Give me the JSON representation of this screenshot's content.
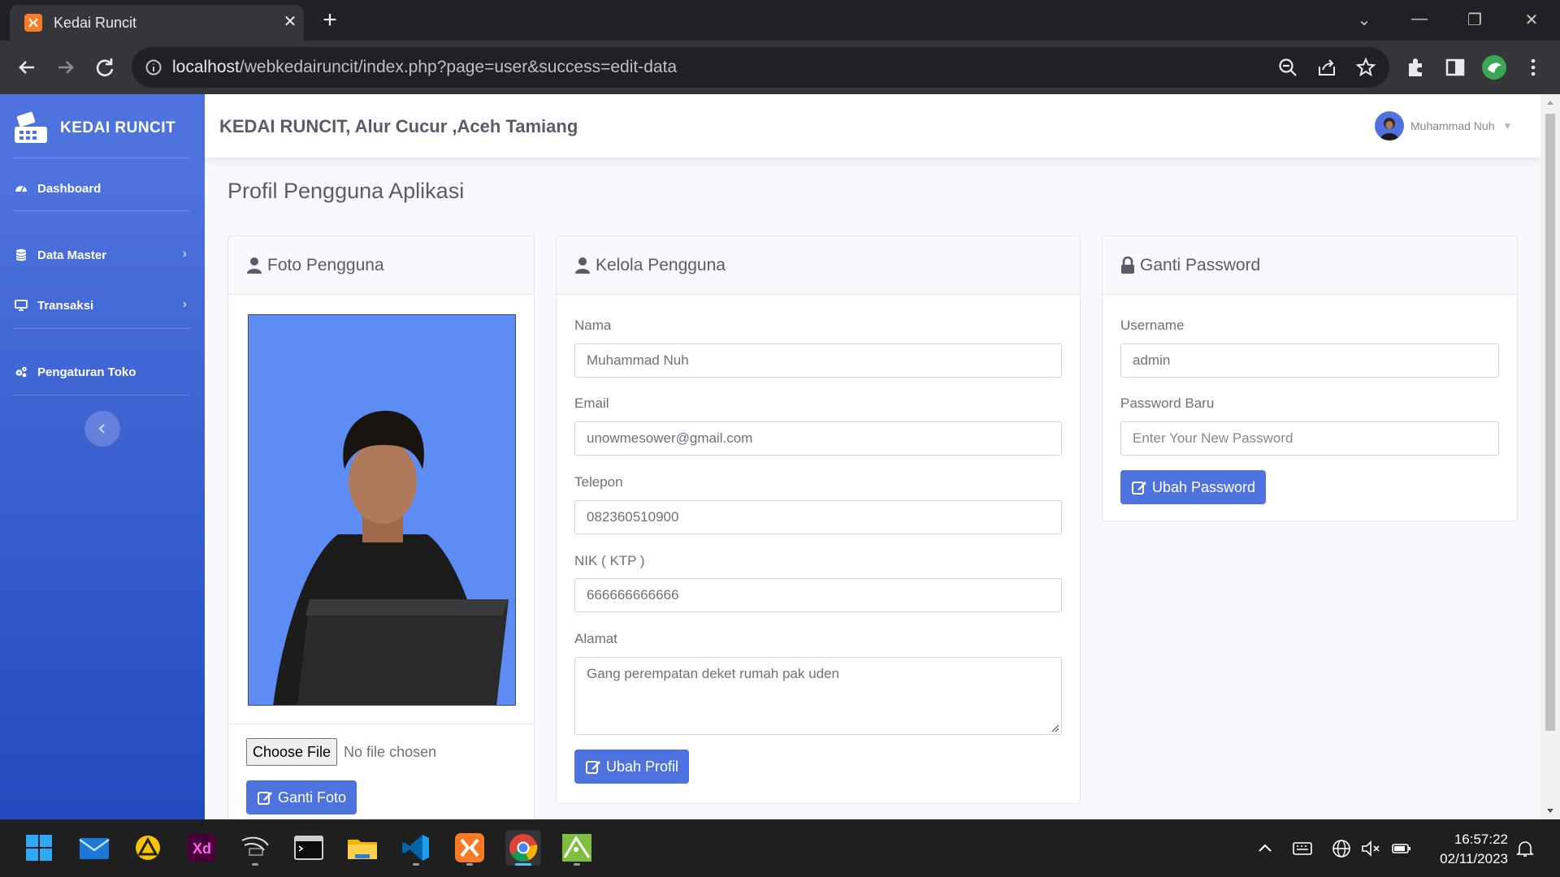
{
  "browser": {
    "tab_title": "Kedai Runcit",
    "url_host": "localhost",
    "url_path": "/webkedairuncit/index.php?page=user&success=edit-data"
  },
  "sidebar": {
    "brand": "KEDAI RUNCIT",
    "items": [
      {
        "label": "Dashboard",
        "icon": "dashboard-icon"
      },
      {
        "label": "Data Master",
        "icon": "database-icon"
      },
      {
        "label": "Transaksi",
        "icon": "desktop-icon"
      },
      {
        "label": "Pengaturan Toko",
        "icon": "cogs-icon"
      }
    ]
  },
  "topbar": {
    "title": "KEDAI RUNCIT, Alur Cucur ,Aceh Tamiang",
    "user_name": "Muhammad Nuh"
  },
  "page": {
    "title": "Profil Pengguna Aplikasi"
  },
  "photo_card": {
    "title": "Foto Pengguna",
    "choose_file": "Choose File",
    "no_file": "No file chosen",
    "button": "Ganti Foto"
  },
  "profile_card": {
    "title": "Kelola Pengguna",
    "fields": {
      "nama_label": "Nama",
      "nama_value": "Muhammad Nuh",
      "email_label": "Email",
      "email_value": "unowmesower@gmail.com",
      "telepon_label": "Telepon",
      "telepon_value": "082360510900",
      "nik_label": "NIK ( KTP )",
      "nik_value": "666666666666",
      "alamat_label": "Alamat",
      "alamat_value": "Gang perempatan deket rumah pak uden"
    },
    "button": "Ubah Profil"
  },
  "password_card": {
    "title": "Ganti Password",
    "username_label": "Username",
    "username_value": "admin",
    "password_label": "Password Baru",
    "password_placeholder": "Enter Your New Password",
    "button": "Ubah Password"
  },
  "taskbar": {
    "time": "16:57:22",
    "date": "02/11/2023"
  },
  "colors": {
    "primary": "#4e73df",
    "sidebar_bottom": "#224abe",
    "photo_bg": "#5d8cf5"
  }
}
